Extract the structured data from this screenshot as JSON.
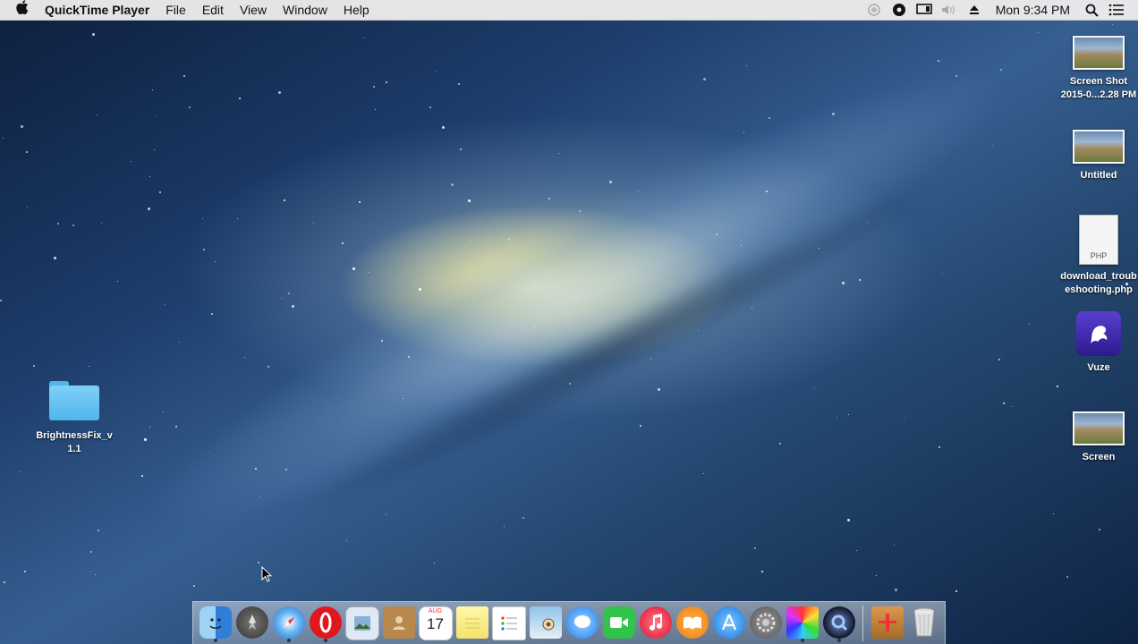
{
  "menubar": {
    "apple_icon": "apple-icon",
    "app_name": "QuickTime Player",
    "menus": [
      "File",
      "Edit",
      "View",
      "Window",
      "Help"
    ],
    "status_icons": [
      "record-icon",
      "gear-icon",
      "airplay-icon",
      "volume-icon",
      "eject-icon"
    ],
    "clock": "Mon 9:34 PM",
    "right_icons": [
      "spotlight-icon",
      "notification-center-icon"
    ]
  },
  "desktop": {
    "icons": [
      {
        "name": "Screen Shot 2015-0...2.28 PM",
        "line1": "Screen Shot",
        "line2": "2015-0...2.28 PM",
        "kind": "image"
      },
      {
        "name": "Untitled",
        "line1": "Untitled",
        "line2": "",
        "kind": "image"
      },
      {
        "name": "download_troubleshooting.php",
        "line1": "download_troub",
        "line2": "eshooting.php",
        "kind": "php-file"
      },
      {
        "name": "Vuze",
        "line1": "Vuze",
        "line2": "",
        "kind": "app-alias"
      },
      {
        "name": "Screen",
        "line1": "Screen",
        "line2": "",
        "kind": "image"
      },
      {
        "name": "BrightnessFix_v1.1",
        "line1": "BrightnessFix_v",
        "line2": "1.1",
        "kind": "folder"
      }
    ],
    "php_badge": "PHP"
  },
  "dock": {
    "apps": [
      {
        "name": "Finder",
        "icon": "finder-icon",
        "running": true
      },
      {
        "name": "Launchpad",
        "icon": "launchpad-icon",
        "running": false
      },
      {
        "name": "Safari",
        "icon": "safari-icon",
        "running": true
      },
      {
        "name": "Opera",
        "icon": "opera-icon",
        "running": true
      },
      {
        "name": "Preview",
        "icon": "preview-icon",
        "running": false
      },
      {
        "name": "Contacts",
        "icon": "contacts-icon",
        "running": false
      },
      {
        "name": "Calendar",
        "icon": "calendar-icon",
        "running": false
      },
      {
        "name": "Notes",
        "icon": "notes-icon",
        "running": false
      },
      {
        "name": "Reminders",
        "icon": "reminders-icon",
        "running": false
      },
      {
        "name": "Photo Booth",
        "icon": "photo-booth-icon",
        "running": false
      },
      {
        "name": "Messages",
        "icon": "messages-icon",
        "running": false
      },
      {
        "name": "FaceTime",
        "icon": "facetime-icon",
        "running": false
      },
      {
        "name": "iTunes",
        "icon": "itunes-icon",
        "running": false
      },
      {
        "name": "iBooks",
        "icon": "ibooks-icon",
        "running": false
      },
      {
        "name": "App Store",
        "icon": "app-store-icon",
        "running": false
      },
      {
        "name": "System Preferences",
        "icon": "system-preferences-icon",
        "running": false
      },
      {
        "name": "Color Picker",
        "icon": "color-cube-icon",
        "running": true
      },
      {
        "name": "QuickTime Player",
        "icon": "quicktime-icon",
        "running": true
      }
    ],
    "calendar_month": "AUG",
    "calendar_day": "17",
    "trash": {
      "name": "Trash",
      "icon": "trash-icon"
    },
    "installer": {
      "name": "Installer",
      "icon": "installer-package-icon"
    }
  }
}
